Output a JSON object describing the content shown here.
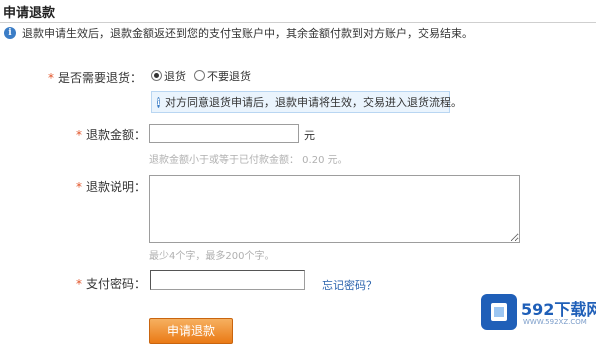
{
  "header": {
    "title": "申请退款"
  },
  "notice": {
    "text": "退款申请生效后，退款金额返还到您的支付宝账户中，其余金额付款到对方账户，交易结束。"
  },
  "form": {
    "required_mark": "*",
    "return_goods": {
      "label": "是否需要退货：",
      "options": [
        "退货",
        "不要退货"
      ],
      "selected": "退货",
      "tip": "对方同意退货申请后，退款申请将生效，交易进入退货流程。"
    },
    "amount": {
      "label": "退款金额：",
      "value": "",
      "unit": "元",
      "hint": "退款金额小于或等于已付款金额： 0.20 元。"
    },
    "description": {
      "label": "退款说明：",
      "value": "",
      "hint": "最少4个字，最多200个字。"
    },
    "password": {
      "label": "支付密码：",
      "value": "",
      "forgot_link": "忘记密码？"
    },
    "submit_label": "申请退款"
  },
  "watermark": {
    "title": "592下载网",
    "url": "WWW.592XZ.COM"
  },
  "colors": {
    "accent_orange": "#ea7a16",
    "link_blue": "#2a62ad",
    "info_blue": "#3b7dc6",
    "required_red": "#e2552a"
  }
}
